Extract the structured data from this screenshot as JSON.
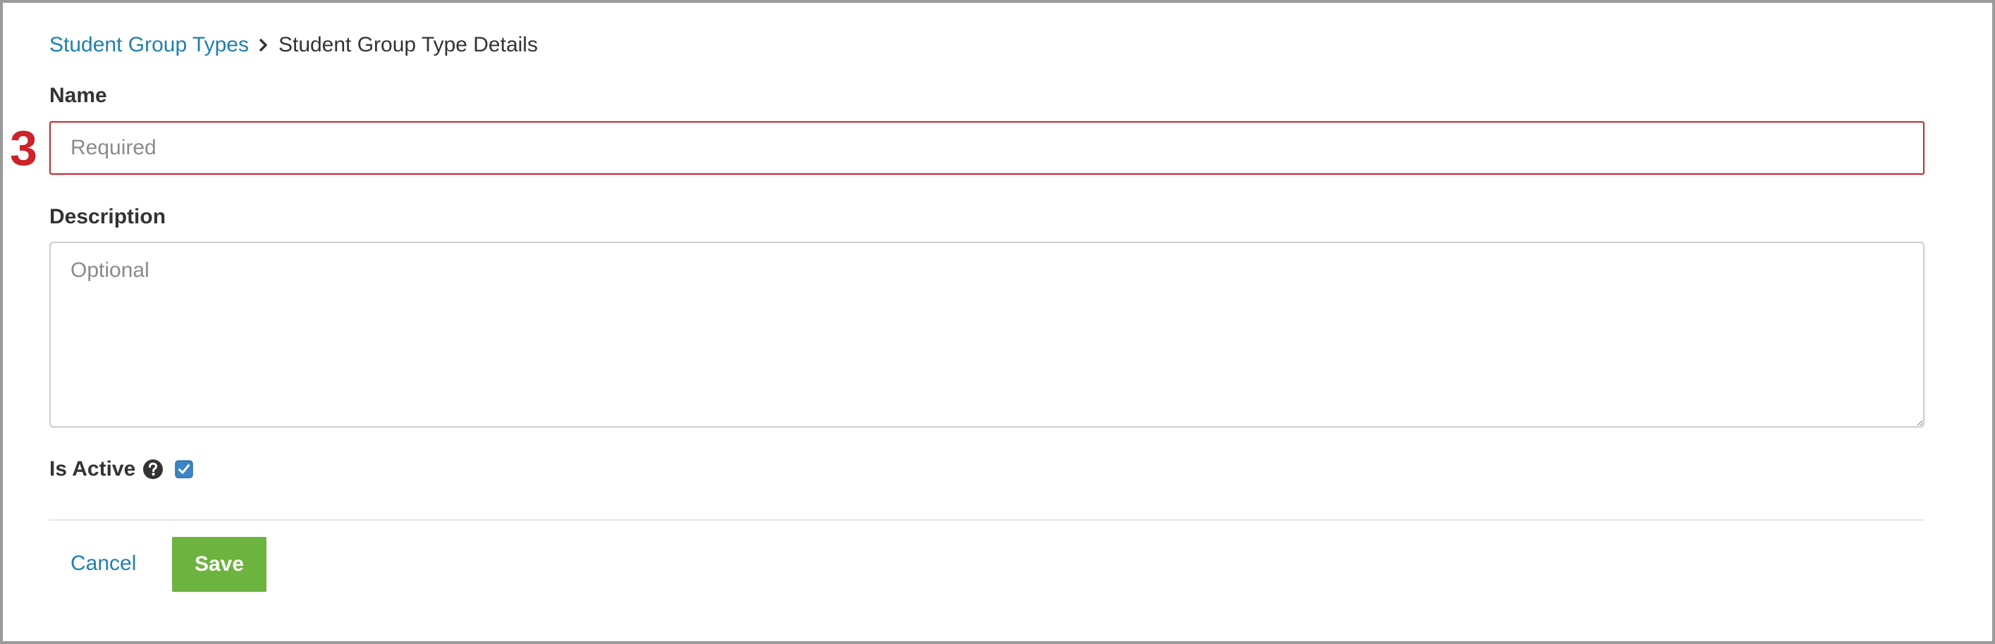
{
  "breadcrumb": {
    "parent_label": "Student Group Types",
    "current_label": "Student Group Type Details"
  },
  "step_marker": "3",
  "form": {
    "name_label": "Name",
    "name_placeholder": "Required",
    "name_value": "",
    "description_label": "Description",
    "description_placeholder": "Optional",
    "description_value": "",
    "is_active_label": "Is Active",
    "is_active_checked": true
  },
  "actions": {
    "cancel_label": "Cancel",
    "save_label": "Save"
  },
  "colors": {
    "link": "#1f7fb0",
    "error_border": "#c9262c",
    "marker": "#cc2229",
    "save_bg": "#6db33f",
    "checkbox": "#3d84c6"
  },
  "icons": {
    "breadcrumb_separator": "chevron-right-icon",
    "help": "question-circle-icon",
    "checkbox": "checkmark-icon"
  }
}
